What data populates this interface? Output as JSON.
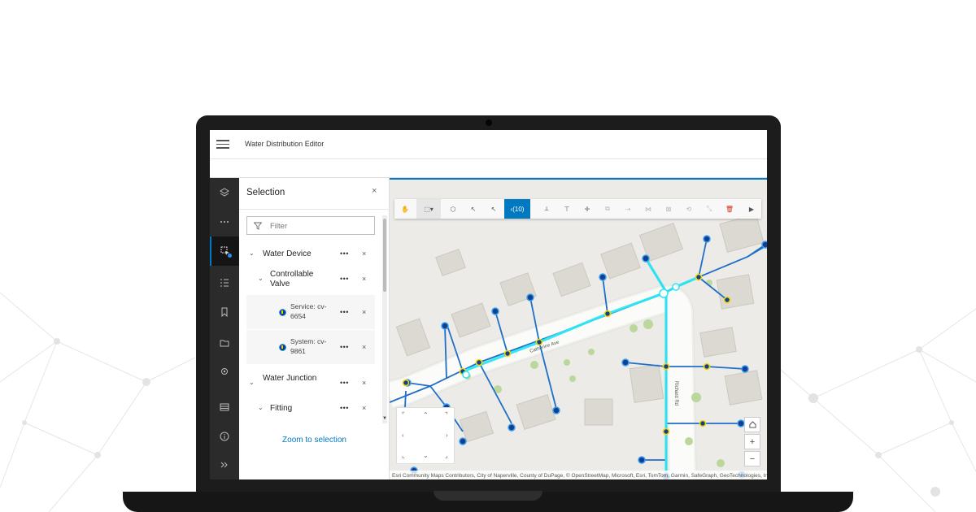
{
  "app": {
    "title": "Water Distribution Editor"
  },
  "action_bar": {
    "items": [
      "layers-icon",
      "more-icon",
      "selection-tool-icon",
      "legend-list-icon",
      "bookmark-icon",
      "folder-icon",
      "settings-icon",
      "table-icon",
      "info-icon",
      "expand-icon"
    ]
  },
  "selection_panel": {
    "title": "Selection",
    "close_glyph": "×",
    "filter_placeholder": "Filter",
    "more_glyph": "•••",
    "remove_glyph": "×",
    "groups": [
      {
        "label": "Water Device"
      },
      {
        "label": "Controllable Valve"
      },
      {
        "label": "Service: cv-6654"
      },
      {
        "label": "System: cv-9861"
      },
      {
        "label": "Water Junction"
      },
      {
        "label": "Fitting"
      }
    ],
    "zoom_label": "Zoom to selection"
  },
  "map": {
    "toolbar_count": "(10)",
    "streets": [
      "Catherine Ave",
      "Richard Rd"
    ],
    "attribution": "Esri Community Maps Contributors, City of Naperville, County of DuPage, © OpenStreetMap, Microsoft, Esri, TomTom, Garmin, SafeGraph, GeoTechnologies, Inc, METI/NASA, USGS, Bureau of Land Management, EPA, NPS, US Census Bureau, USDA",
    "zoom_in": "+",
    "zoom_out": "−",
    "colors": {
      "main": "#1f6fc9",
      "highlight": "#2ee6f2",
      "node_fill": "#123f91",
      "accent": "#0079c1"
    }
  }
}
